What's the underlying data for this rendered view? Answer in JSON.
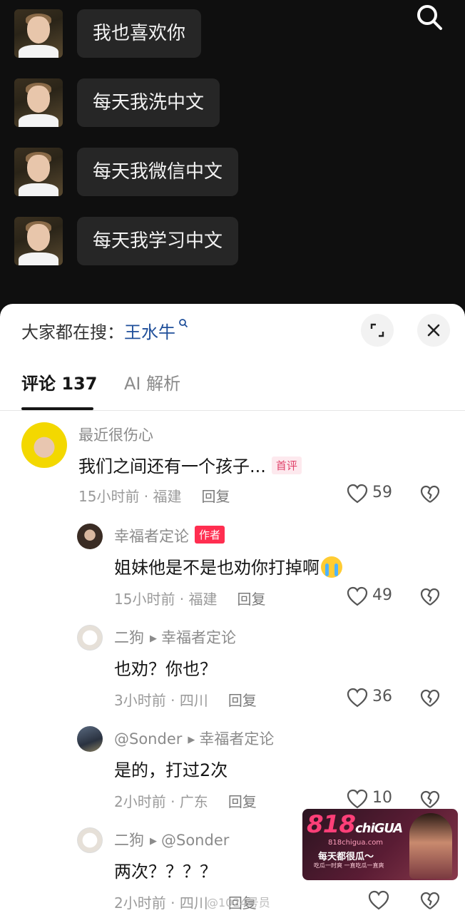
{
  "chat": {
    "messages": [
      {
        "text": "我也喜欢你"
      },
      {
        "text": "每天我洗中文"
      },
      {
        "text": "每天我微信中文"
      },
      {
        "text": "每天我学习中文"
      }
    ]
  },
  "sheet": {
    "search_prefix": "大家都在搜：",
    "search_keyword": "王水牛",
    "tabs": {
      "comments": "评论 137",
      "ai": "AI 解析"
    }
  },
  "comments": [
    {
      "name": "最近很伤心",
      "text": "我们之间还有一个孩子...",
      "badge": "首评",
      "time": "15小时前",
      "location": "福建",
      "reply_label": "回复",
      "likes": "59"
    },
    {
      "name": "幸福者定论",
      "badge": "作者",
      "text": "姐妹他是不是也劝你打掉啊",
      "time": "15小时前",
      "location": "福建",
      "reply_label": "回复",
      "likes": "49"
    },
    {
      "name": "二狗",
      "reply_to": "幸福者定论",
      "text": "也劝？你也？",
      "time": "3小时前",
      "location": "四川",
      "reply_label": "回复",
      "likes": "36"
    },
    {
      "name": "@Sonder",
      "reply_to": "幸福者定论",
      "text": "是的，打过2次",
      "time": "2小时前",
      "location": "广东",
      "reply_label": "回复",
      "likes": "10"
    },
    {
      "name": "二狗",
      "reply_to": "@Sonder",
      "text": "两次？？？？",
      "time": "2小时前",
      "location": "四川",
      "reply_label": "回复",
      "likes": ""
    }
  ],
  "ad": {
    "logo": "818",
    "logo_suffix": "chiGUA",
    "url": "818chigua.com",
    "slogan": "每天都很瓜～",
    "sub": "吃瓜一时爽 一直吃瓜一直爽"
  },
  "watermark": "@1024号员"
}
